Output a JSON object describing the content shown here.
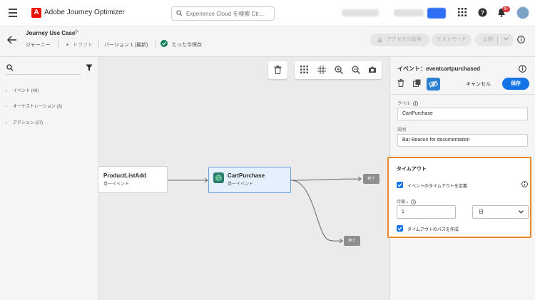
{
  "topbar": {
    "app_name": "Adobe Journey Optimizer",
    "logo_letter": "A",
    "search_placeholder": "Experience Cloud を検索 Ctr...",
    "notification_count": "9+",
    "brand_color": "#eb1000",
    "accent_color": "#1473e6",
    "icons": [
      "menu-icon",
      "search-icon",
      "apps-grid-icon",
      "help-icon",
      "bell-icon",
      "user-avatar"
    ]
  },
  "header": {
    "journey_name": "Journey Use Case",
    "type_label": "ジャーニー",
    "status": "ドラフト",
    "version": "バージョン 1 (最新)",
    "saved_status": "たった今保存",
    "buttons": {
      "access": "アクセスの管理",
      "test_mode": "テストモード",
      "publish": "公開"
    }
  },
  "left_panel": {
    "categories": [
      {
        "label": "イベント (49)"
      },
      {
        "label": "オーケストレーション (3)"
      },
      {
        "label": "アクション (27)"
      }
    ]
  },
  "canvas": {
    "nodes": {
      "product_list_add": {
        "title": "ProductListAdd",
        "subtitle": "単一イベント"
      },
      "cart_purchase": {
        "title": "CartPurchase",
        "subtitle": "単一イベント"
      }
    },
    "end_label_1": "終了",
    "end_label_2": "終了"
  },
  "right_panel": {
    "title": "イベント：eventcartpurchased",
    "cancel_label": "キャンセル",
    "save_label": "保存",
    "label_field": {
      "label": "ラベル",
      "value": "CartPurchase"
    },
    "description_field": {
      "label": "説明",
      "value": "Bar Beacon for documentation"
    },
    "timeout": {
      "title": "タイムアウト",
      "define_timeout_label": "イベントのタイムアウトを定義",
      "define_timeout_checked": true,
      "wait_label": "待機",
      "wait_required_marker": "●",
      "wait_value": "1",
      "unit_value": "日",
      "create_path_label": "タイムアウトのパスを作成",
      "create_path_checked": true,
      "highlight_color": "#e8882b"
    }
  }
}
